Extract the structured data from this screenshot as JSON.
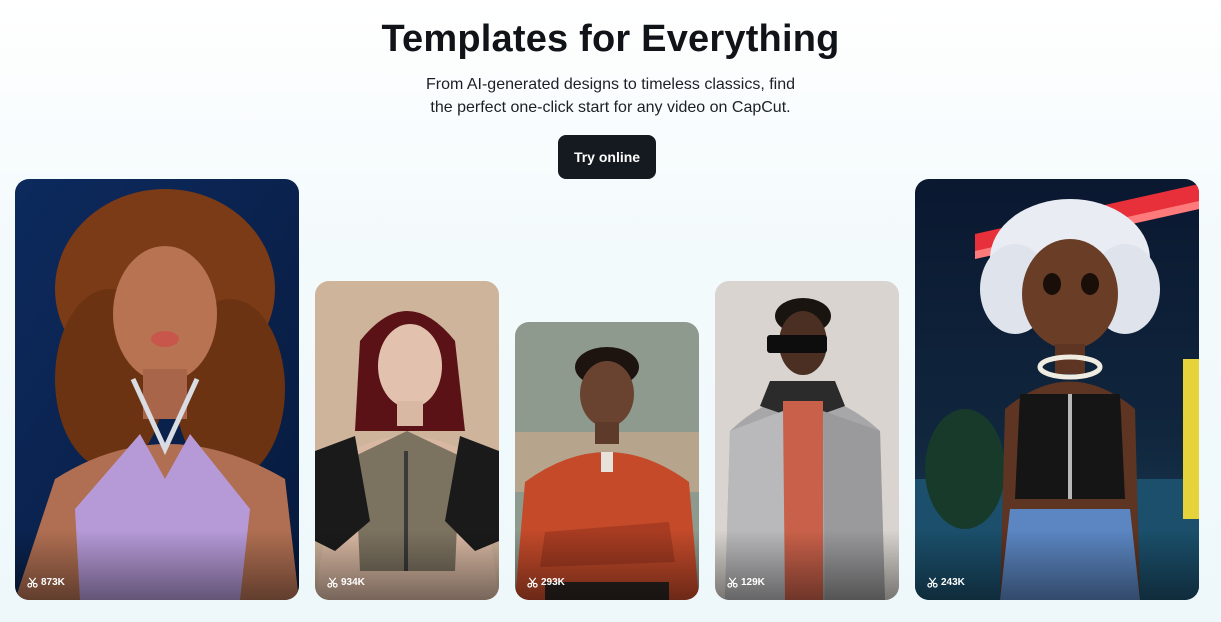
{
  "hero": {
    "title": "Templates for Everything",
    "subtitle_line1": "From AI-generated designs to timeless classics, find",
    "subtitle_line2": "the perfect one-click start for any video on CapCut.",
    "cta_label": "Try online"
  },
  "cards": [
    {
      "usage": "873K",
      "icon": "scissors-icon"
    },
    {
      "usage": "934K",
      "icon": "scissors-icon"
    },
    {
      "usage": "293K",
      "icon": "scissors-icon"
    },
    {
      "usage": "129K",
      "icon": "scissors-icon"
    },
    {
      "usage": "243K",
      "icon": "scissors-icon"
    }
  ],
  "colors": {
    "cta_background": "#141a1f",
    "title": "#101418"
  }
}
